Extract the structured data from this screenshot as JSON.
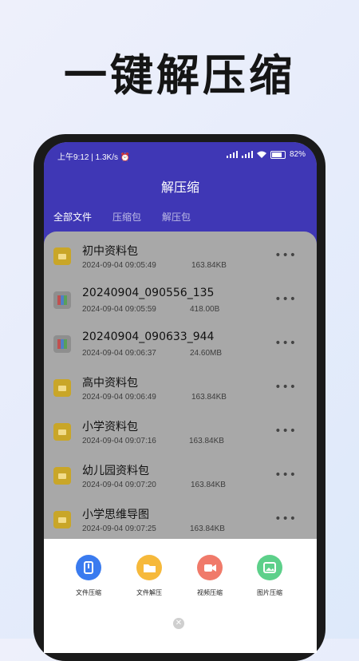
{
  "promo": {
    "title": "一键解压缩"
  },
  "status_bar": {
    "time": "上午9:12 | 1.3K/s",
    "battery": "82"
  },
  "header": {
    "title": "解压缩"
  },
  "tabs": [
    {
      "label": "全部文件",
      "active": true
    },
    {
      "label": "压缩包",
      "active": false
    },
    {
      "label": "解压包",
      "active": false
    }
  ],
  "files": [
    {
      "name": "初中资料包",
      "date": "2024-09-04 09:05:49",
      "size": "163.84KB",
      "icon": "folder-icon"
    },
    {
      "name": "20240904_090556_135",
      "date": "2024-09-04 09:05:59",
      "size": "418.00B",
      "icon": "rar-icon"
    },
    {
      "name": "20240904_090633_944",
      "date": "2024-09-04 09:06:37",
      "size": "24.60MB",
      "icon": "rar-icon"
    },
    {
      "name": "高中资料包",
      "date": "2024-09-04 09:06:49",
      "size": "163.84KB",
      "icon": "folder-icon"
    },
    {
      "name": "小学资料包",
      "date": "2024-09-04 09:07:16",
      "size": "163.84KB",
      "icon": "folder-icon"
    },
    {
      "name": "幼儿园资料包",
      "date": "2024-09-04 09:07:20",
      "size": "163.84KB",
      "icon": "folder-icon"
    },
    {
      "name": "小学思维导图",
      "date": "2024-09-04 09:07:25",
      "size": "163.84KB",
      "icon": "folder-icon"
    }
  ],
  "more_glyph": "•••",
  "tools": [
    {
      "label": "文件压缩",
      "icon": "file-compress-icon",
      "color": "#3a7bef"
    },
    {
      "label": "文件解压",
      "icon": "folder-open-icon",
      "color": "#f6b93b"
    },
    {
      "label": "视频压缩",
      "icon": "video-icon",
      "color": "#f07a6a"
    },
    {
      "label": "图片压缩",
      "icon": "image-icon",
      "color": "#5dd08a"
    }
  ],
  "close_glyph": "✕"
}
